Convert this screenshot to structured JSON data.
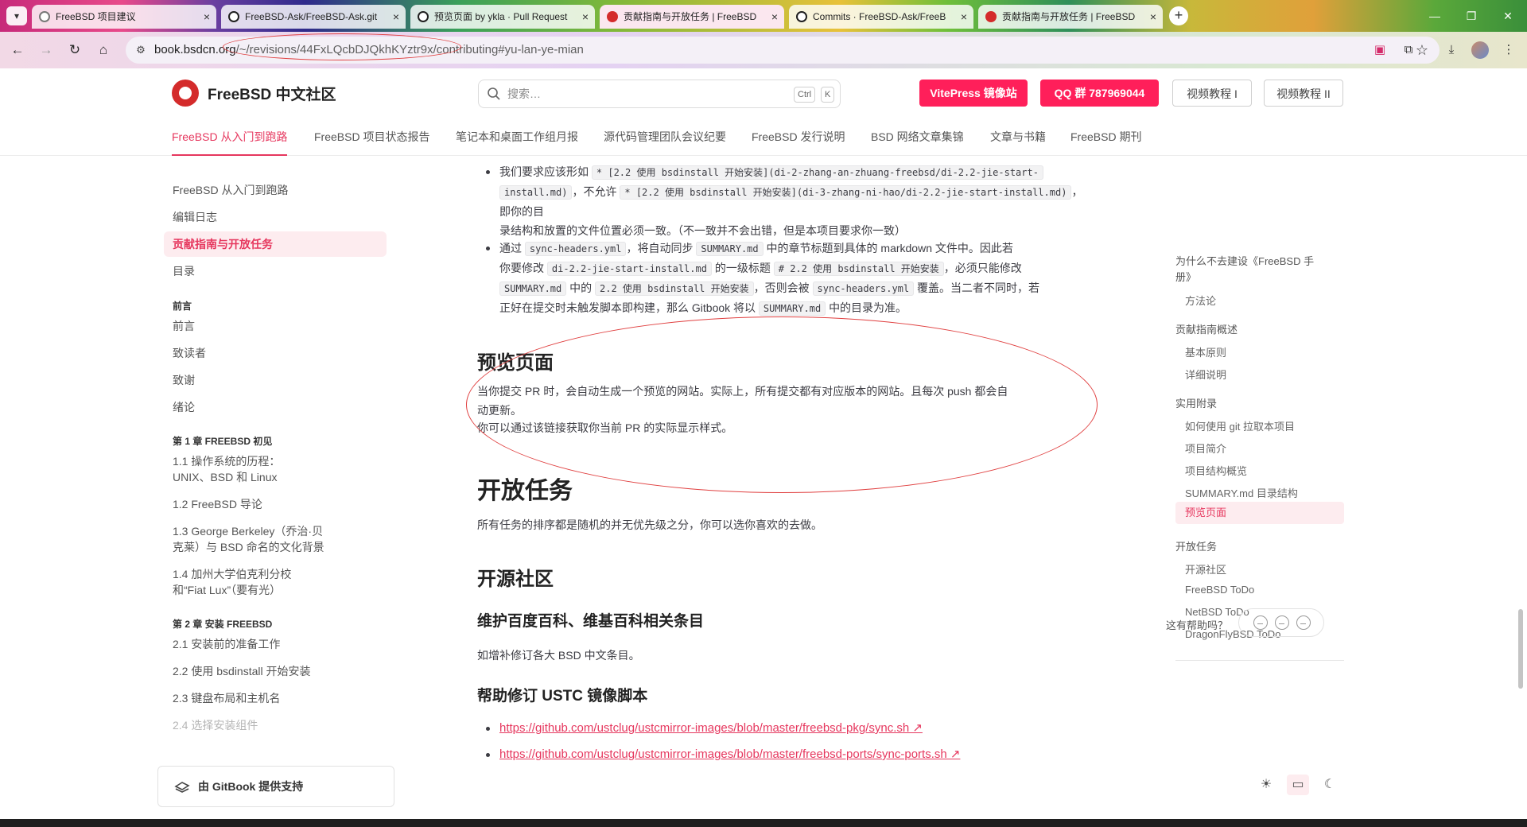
{
  "browser": {
    "tabs": [
      {
        "title": "FreeBSD 项目建议",
        "icon": "gear-icon"
      },
      {
        "title": "FreeBSD-Ask/FreeBSD-Ask.git",
        "icon": "github-icon"
      },
      {
        "title": "预览页面 by ykla · Pull Request",
        "icon": "github-icon"
      },
      {
        "title": "贡献指南与开放任务 | FreeBSD",
        "icon": "freebsd-icon"
      },
      {
        "title": "Commits · FreeBSD-Ask/FreeB",
        "icon": "github-icon"
      },
      {
        "title": "贡献指南与开放任务 | FreeBSD",
        "icon": "freebsd-icon"
      }
    ],
    "url_host": "book.bsdcn.org",
    "url_rest": "/~/revisions/44FxLQcbDJQkhKYztr9x/contributing#yu-lan-ye-mian"
  },
  "header": {
    "site_name": "FreeBSD 中文社区",
    "search_placeholder": "搜索…",
    "kbd_ctrl": "Ctrl",
    "kbd_k": "K",
    "btn_vitepress": "VitePress 镜像站",
    "btn_qq": "QQ 群 787969044",
    "btn_video1": "视频教程 I",
    "btn_video2": "视频教程 II"
  },
  "subnav": [
    "FreeBSD 从入门到跑路",
    "FreeBSD 项目状态报告",
    "笔记本和桌面工作组月报",
    "源代码管理团队会议纪要",
    "FreeBSD 发行说明",
    "BSD 网络文章集锦",
    "文章与书籍",
    "FreeBSD 期刊"
  ],
  "sidebar": {
    "items_top": [
      "FreeBSD 从入门到跑路",
      "编辑日志",
      "贡献指南与开放任务",
      "目录"
    ],
    "section_preface": "前言",
    "preface_items": [
      "前言",
      "致读者",
      "致谢",
      "绪论"
    ],
    "section_ch1": "第 1 章 FREEBSD 初见",
    "ch1_items": [
      "1.1 操作系统的历程：",
      "UNIX、BSD 和 Linux",
      "1.2 FreeBSD 导论",
      "1.3 George Berkeley（乔治·贝",
      "克莱）与 BSD 命名的文化背景",
      "1.4 加州大学伯克利分校",
      "和“Fiat Lux”（要有光）"
    ],
    "section_ch2": "第 2 章 安装 FREEBSD",
    "ch2_items": [
      "2.1 安装前的准备工作",
      "2.2 使用 bsdinstall 开始安装",
      "2.3 键盘布局和主机名",
      "2.4 选择安装组件"
    ],
    "gitbook": "由 GitBook 提供支持"
  },
  "content": {
    "b1_a": "我们要求应该形如",
    "b1_code1a": "* [2.2 使用 bsdinstall 开始安装](di-2-zhang-an-zhuang-freebsd/di-2.2-jie-start-",
    "b1_code1b": "install.md)",
    "b1_b": "，不允许",
    "b1_code2": "* [2.2 使用 bsdinstall 开始安装](di-3-zhang-ni-hao/di-2.2-jie-start-install.md)",
    "b1_c": "，即你的目",
    "b1_d": "录结构和放置的文件位置必须一致。（不一致并不会出错，但是本项目要求你一致）",
    "b2_a": "通过",
    "b2_code1": "sync-headers.yml",
    "b2_b": "，将自动同步",
    "b2_code2": "SUMMARY.md",
    "b2_c": "中的章节标题到具体的 markdown 文件中。因此若",
    "b2_d": "你要修改",
    "b2_code3": "di-2.2-jie-start-install.md",
    "b2_e": "的一级标题",
    "b2_code4": "# 2.2 使用 bsdinstall 开始安装",
    "b2_f": "，必须只能修改",
    "b2_code5": "SUMMARY.md",
    "b2_g": "中的",
    "b2_code6": "2.2 使用 bsdinstall 开始安装",
    "b2_h": "，否则会被",
    "b2_code7": "sync-headers.yml",
    "b2_i": "覆盖。当二者不同时，若",
    "b2_j": "正好在提交时未触发脚本即构建，那么 Gitbook 将以",
    "b2_code8": "SUMMARY.md",
    "b2_k": "中的目录为准。",
    "h_preview": "预览页面",
    "p_preview1a": "当你提交 PR 时，会自动生成一个预览的网站。实际上，所有提交都有对应版本的网站。且每次 push 都会自",
    "p_preview1b": "动更新。",
    "p_preview2": "你可以通过该链接获取你当前 PR 的实际显示样式。",
    "h_open": "开放任务",
    "p_open": "所有任务的排序都是随机的并无优先级之分，你可以选你喜欢的去做。",
    "h_community": "开源社区",
    "h_wiki": "维护百度百科、维基百科相关条目",
    "p_wiki": "如增补修订各大 BSD 中文条目。",
    "h_ustc": "帮助修订 USTC 镜像脚本",
    "link1": "https://github.com/ustclug/ustcmirror-images/blob/master/freebsd-pkg/sync.sh ↗",
    "link2": "https://github.com/ustclug/ustcmirror-images/blob/master/freebsd-ports/sync-ports.sh ↗"
  },
  "toc": {
    "t1a": "为什么不去建设《FreeBSD 手",
    "t1b": "册》",
    "t1_sub": "方法论",
    "t2": "贡献指南概述",
    "t2_subs": [
      "基本原则",
      "详细说明"
    ],
    "t3": "实用附录",
    "t3_subs": [
      "如何使用 git 拉取本项目",
      "项目简介",
      "项目结构概览",
      "SUMMARY.md 目录结构",
      "预览页面"
    ],
    "t4": "开放任务",
    "t4_subs": [
      "开源社区",
      "FreeBSD ToDo",
      "NetBSD ToDo",
      "DragonFlyBSD ToDo"
    ],
    "feedback": "这有帮助吗？"
  },
  "colors": {
    "accent": "#e6375e",
    "button_red": "#ff1f5a",
    "annotation": "#e04040"
  }
}
